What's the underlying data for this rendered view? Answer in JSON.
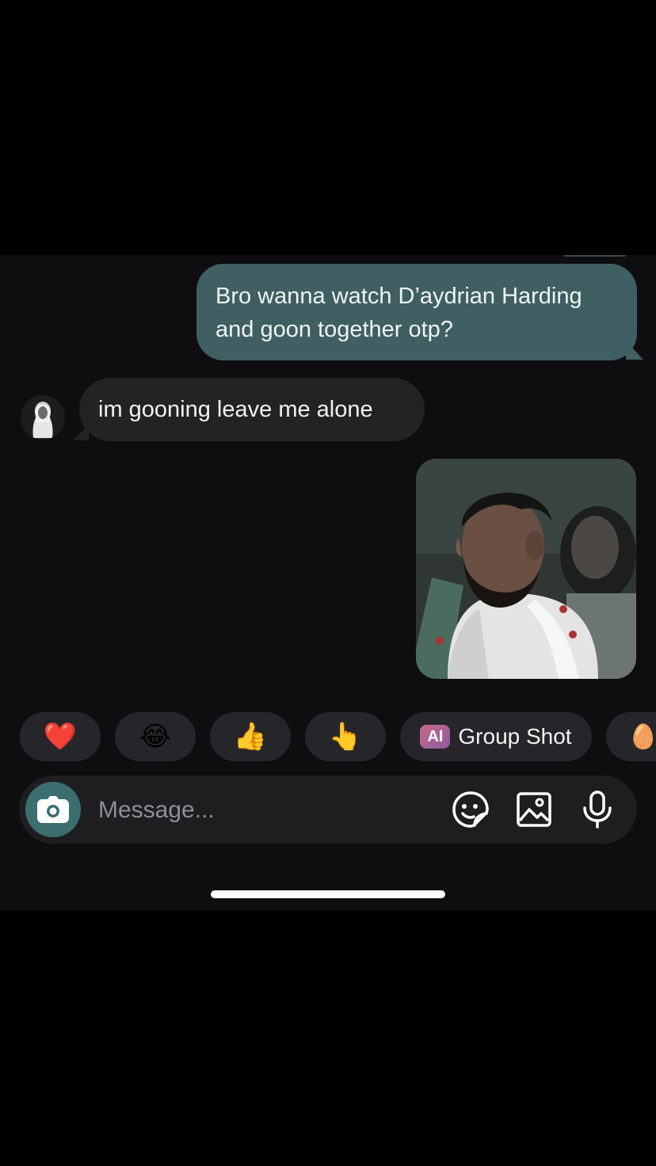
{
  "messages": {
    "outgoing_text": "Bro wanna watch D’aydrian Harding and goon together otp?",
    "incoming_text": "im gooning leave me alone"
  },
  "reactions": {
    "heart": "❤️",
    "laugh": "😂",
    "thumbs_up": "👍",
    "pointing": "👆",
    "group_shot_badge": "AI",
    "group_shot_label": "Group Shot",
    "egg": "🥚"
  },
  "composer": {
    "placeholder": "Message..."
  },
  "colors": {
    "outgoing_bubble": "#3f5f62",
    "incoming_bubble": "#232326",
    "camera_button": "#3c6e70",
    "background": "#0e0e10"
  },
  "icons": [
    "camera-icon",
    "sticker-icon",
    "gallery-icon",
    "microphone-icon"
  ]
}
